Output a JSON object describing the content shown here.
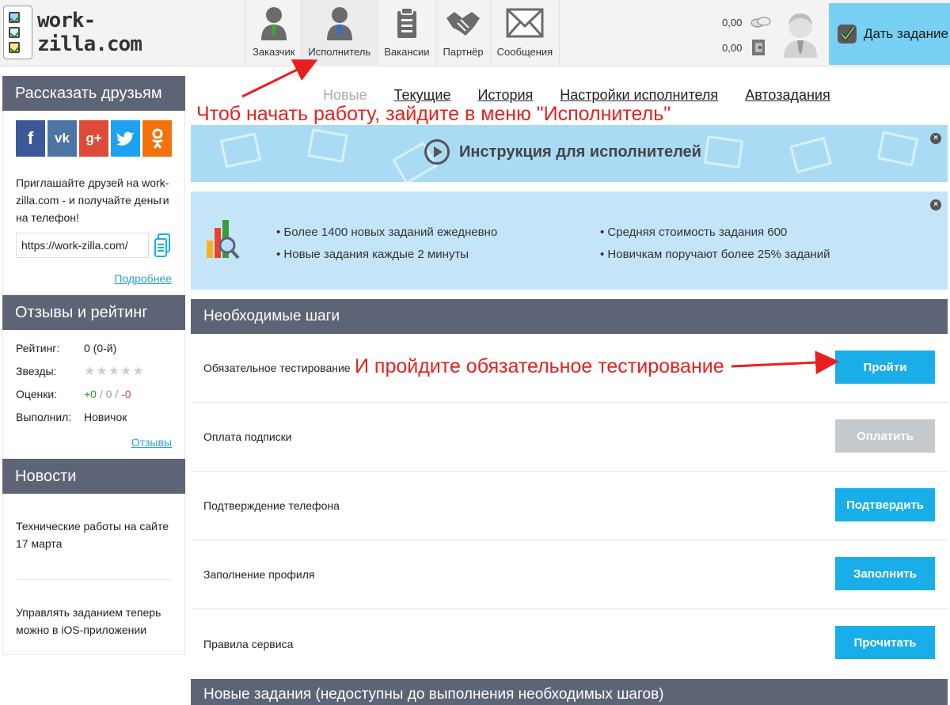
{
  "header": {
    "logo_text": "work-zilla.com",
    "nav": [
      {
        "label": "Заказчик",
        "icon": "customer-icon"
      },
      {
        "label": "Исполнитель",
        "icon": "freelancer-icon"
      },
      {
        "label": "Вакансии",
        "icon": "vacancies-icon"
      },
      {
        "label": "Партнёр",
        "icon": "handshake-icon"
      },
      {
        "label": "Сообщения",
        "icon": "envelope-icon"
      }
    ],
    "balance_money": "0,00",
    "balance_bonus": "0,00",
    "cta_label": "Дать задание"
  },
  "sidebar": {
    "share": {
      "title": "Рассказать друзьям",
      "networks": [
        {
          "label": "f",
          "color": "#3b5998"
        },
        {
          "label": "vk",
          "color": "#4c75a3"
        },
        {
          "label": "g+",
          "color": "#dd4b39"
        },
        {
          "label": "tw",
          "color": "#1da1f2"
        },
        {
          "label": "ok",
          "color": "#f2720c"
        }
      ],
      "invite_text": "Приглашайте друзей на work-zilla.com - и получайте деньги на телефон!",
      "link_value": "https://work-zilla.com/",
      "more_label": "Подробнее"
    },
    "rating": {
      "title": "Отзывы и рейтинг",
      "rating_label": "Рейтинг:",
      "rating_value": "0 (0-й)",
      "stars_label": "Звезды:",
      "stars_value": "★★★★★",
      "grades_label": "Оценки:",
      "grade_pos": "+0",
      "grade_sep1": " / ",
      "grade_neutral": "0",
      "grade_sep2": " / ",
      "grade_neg": "-0",
      "done_label": "Выполнил:",
      "done_value": "Новичок",
      "reviews_label": "Отзывы"
    },
    "news": {
      "title": "Новости",
      "items": [
        "Технические работы на сайте 17 марта",
        "Управлять заданием теперь можно в iOS-приложении"
      ]
    }
  },
  "main": {
    "tabs": [
      "Новые",
      "Текущие",
      "История",
      "Настройки исполнителя",
      "Автозадания"
    ],
    "instruction_label": "Инструкция для исполнителей",
    "close_glyph": "×",
    "facts_left": [
      "• Более 1400 новых заданий ежедневно",
      "• Новые задания каждые 2 минуты"
    ],
    "facts_right": [
      "• Средняя стоимость задания 600",
      "• Новичкам поручают более 25% заданий"
    ],
    "steps_title": "Необходимые шаги",
    "steps": [
      {
        "label": "Обязательное тестирование",
        "button": "Пройти",
        "enabled": true
      },
      {
        "label": "Оплата подписки",
        "button": "Оплатить",
        "enabled": false
      },
      {
        "label": "Подтверждение телефона",
        "button": "Подтвердить",
        "enabled": true
      },
      {
        "label": "Заполнение профиля",
        "button": "Заполнить",
        "enabled": true
      },
      {
        "label": "Правила сервиса",
        "button": "Прочитать",
        "enabled": true
      }
    ],
    "new_tasks_title": "Новые задания (недоступны до выполнения необходимых шагов)"
  },
  "annotations": {
    "menu_hint": "Чтоб начать работу, зайдите в меню \"Исполнитель\"",
    "test_hint": "И пройдите обязательное тестирование",
    "color": "#e8201d"
  }
}
